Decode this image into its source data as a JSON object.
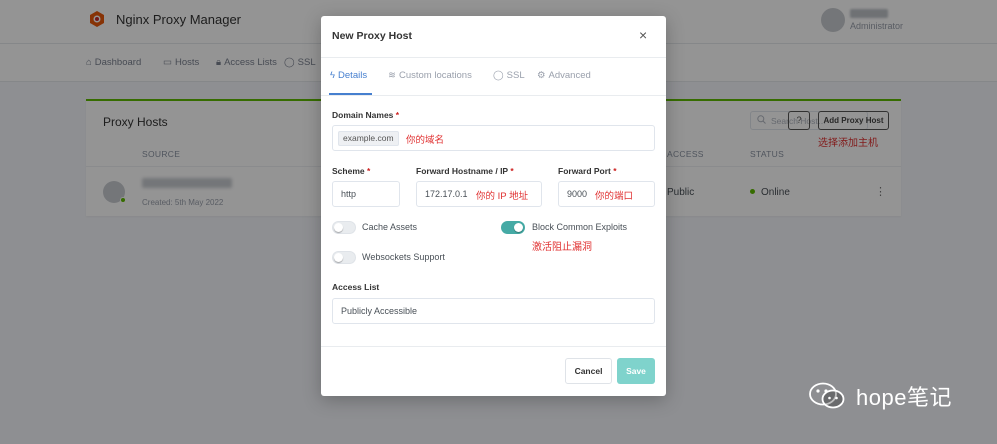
{
  "app": {
    "title": "Nginx Proxy Manager",
    "user_role": "Administrator"
  },
  "nav": {
    "dashboard": "Dashboard",
    "hosts": "Hosts",
    "access_lists": "Access Lists",
    "ssl": "SSL"
  },
  "card": {
    "title": "Proxy Hosts",
    "search_placeholder": "Search Host…",
    "help": "?",
    "add_button": "Add Proxy Host",
    "add_note": "选择添加主机",
    "columns": {
      "source": "SOURCE",
      "access": "ACCESS",
      "status": "STATUS"
    },
    "row": {
      "created": "Created: 5th May 2022",
      "access": "Public",
      "status": "Online",
      "menu": "⋮"
    }
  },
  "modal": {
    "title": "New Proxy Host",
    "close": "×",
    "tabs": {
      "details": "Details",
      "custom_locations": "Custom locations",
      "ssl": "SSL",
      "advanced": "Advanced"
    },
    "domain": {
      "label": "Domain Names",
      "chip": "example.com",
      "note": "你的域名"
    },
    "scheme": {
      "label": "Scheme",
      "value": "http"
    },
    "forward_host": {
      "label": "Forward Hostname / IP",
      "value": "172.17.0.1",
      "note": "你的 IP 地址"
    },
    "forward_port": {
      "label": "Forward Port",
      "value": "9000",
      "note": "你的端口"
    },
    "required_mark": "*",
    "toggles": {
      "cache_assets": {
        "label": "Cache Assets",
        "on": false
      },
      "block_exploits": {
        "label": "Block Common Exploits",
        "on": true,
        "note": "激活阻止漏洞"
      },
      "websockets": {
        "label": "Websockets Support",
        "on": false
      }
    },
    "access_list": {
      "label": "Access List",
      "value": "Publicly Accessible"
    },
    "cancel": "Cancel",
    "save": "Save"
  },
  "watermark": {
    "text": "hope笔记"
  },
  "colors": {
    "accent": "#467fcf",
    "toggle_on": "#45aaa5",
    "save": "#7fd3cc",
    "online": "#5eba00",
    "note": "#e03131"
  }
}
